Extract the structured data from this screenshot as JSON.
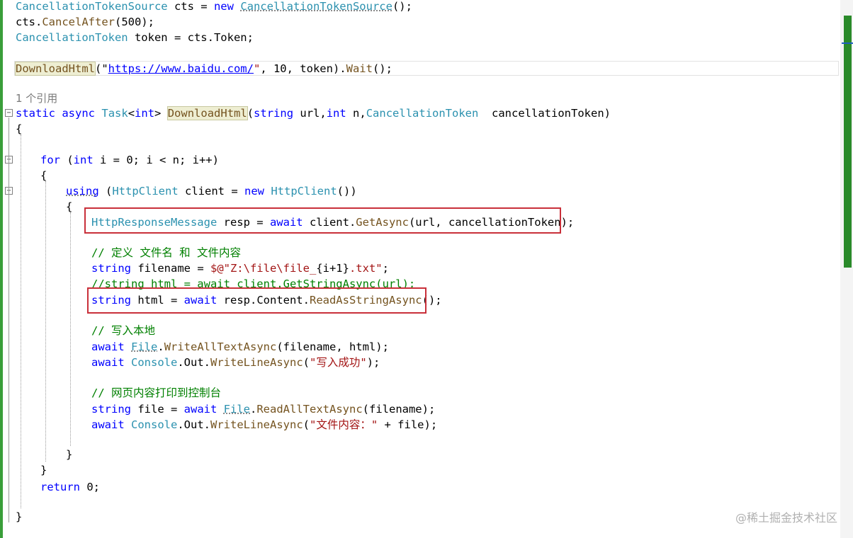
{
  "code": {
    "l1": {
      "t1": "CancellationTokenSource",
      "t2": " cts = ",
      "t3": "new",
      "t4": " ",
      "t5": "CancellationTokenSource",
      "t6": "();"
    },
    "l2": {
      "t1": "cts.",
      "t2": "CancelAfter",
      "t3": "(500);"
    },
    "l3": {
      "t1": "CancellationToken",
      "t2": " token = cts.Token;"
    },
    "l4": {
      "t1": "DownloadHtml",
      "t2": "(\"",
      "t3": "https://www.baidu.com/",
      "t4": "\"",
      "t5": ", 10, token).",
      "t6": "Wait",
      "t7": "();"
    },
    "refs": "1 个引用",
    "l5": {
      "t1": "static",
      "t2": " ",
      "t3": "async",
      "t4": " ",
      "t5": "Task",
      "t6": "<",
      "t7": "int",
      "t8": "> ",
      "t9": "DownloadHtml",
      "t10": "(",
      "t11": "string",
      "t12": " url,",
      "t13": "int",
      "t14": " n,",
      "t15": "CancellationToken",
      "t16": "  cancellationToken)"
    },
    "l6": "{",
    "l7": {
      "t1": "for",
      "t2": " (",
      "t3": "int",
      "t4": " i = 0; i < n; i++)"
    },
    "l8": "{",
    "l9": {
      "t1": "using",
      "t2": " (",
      "t3": "HttpClient",
      "t4": " client = ",
      "t5": "new",
      "t6": " ",
      "t7": "HttpClient",
      "t8": "())"
    },
    "l10": "{",
    "l11": {
      "t1": "HttpResponseMessage",
      "t2": " resp = ",
      "t3": "await",
      "t4": " client.",
      "t5": "GetAsync",
      "t6": "(url, cancellationToken);"
    },
    "l12": "// 定义 文件名 和 文件内容",
    "l13": {
      "t1": "string",
      "t2": " filename = ",
      "t3": "$@\"Z:\\file\\file_",
      "t4": "{i+1}",
      "t5": ".txt\"",
      "t6": ";"
    },
    "l14": "//string html = await client.GetStringAsync(url);",
    "l15": {
      "t1": "string",
      "t2": " html = ",
      "t3": "await",
      "t4": " resp.Content.",
      "t5": "ReadAsStringAsync",
      "t6": "();"
    },
    "l16": "// 写入本地",
    "l17": {
      "t1": "await",
      "t2": " ",
      "t3": "File",
      "t4": ".",
      "t5": "WriteAllTextAsync",
      "t6": "(filename, html);"
    },
    "l18": {
      "t1": "await",
      "t2": " ",
      "t3": "Console",
      "t4": ".Out.",
      "t5": "WriteLineAsync",
      "t6": "(",
      "t7": "\"写入成功\"",
      "t8": ");"
    },
    "l19": "// 网页内容打印到控制台",
    "l20": {
      "t1": "string",
      "t2": " file = ",
      "t3": "await",
      "t4": " ",
      "t5": "File",
      "t6": ".",
      "t7": "ReadAllTextAsync",
      "t8": "(filename);"
    },
    "l21": {
      "t1": "await",
      "t2": " ",
      "t3": "Console",
      "t4": ".Out.",
      "t5": "WriteLineAsync",
      "t6": "(",
      "t7": "\"文件内容：\"",
      "t8": " + file);"
    },
    "l22": "}",
    "l23": "}",
    "l24": {
      "t1": "return",
      "t2": " 0;"
    },
    "l25": "}"
  },
  "outline_toggle": "−",
  "watermark": "@稀土掘金技术社区",
  "colors": {
    "keyword": "#0000ff",
    "type": "#2b91af",
    "method": "#74531f",
    "string": "#a31515",
    "comment": "#008000",
    "highlight_box": "#c9303a",
    "change_bar": "#3a9e3a"
  }
}
